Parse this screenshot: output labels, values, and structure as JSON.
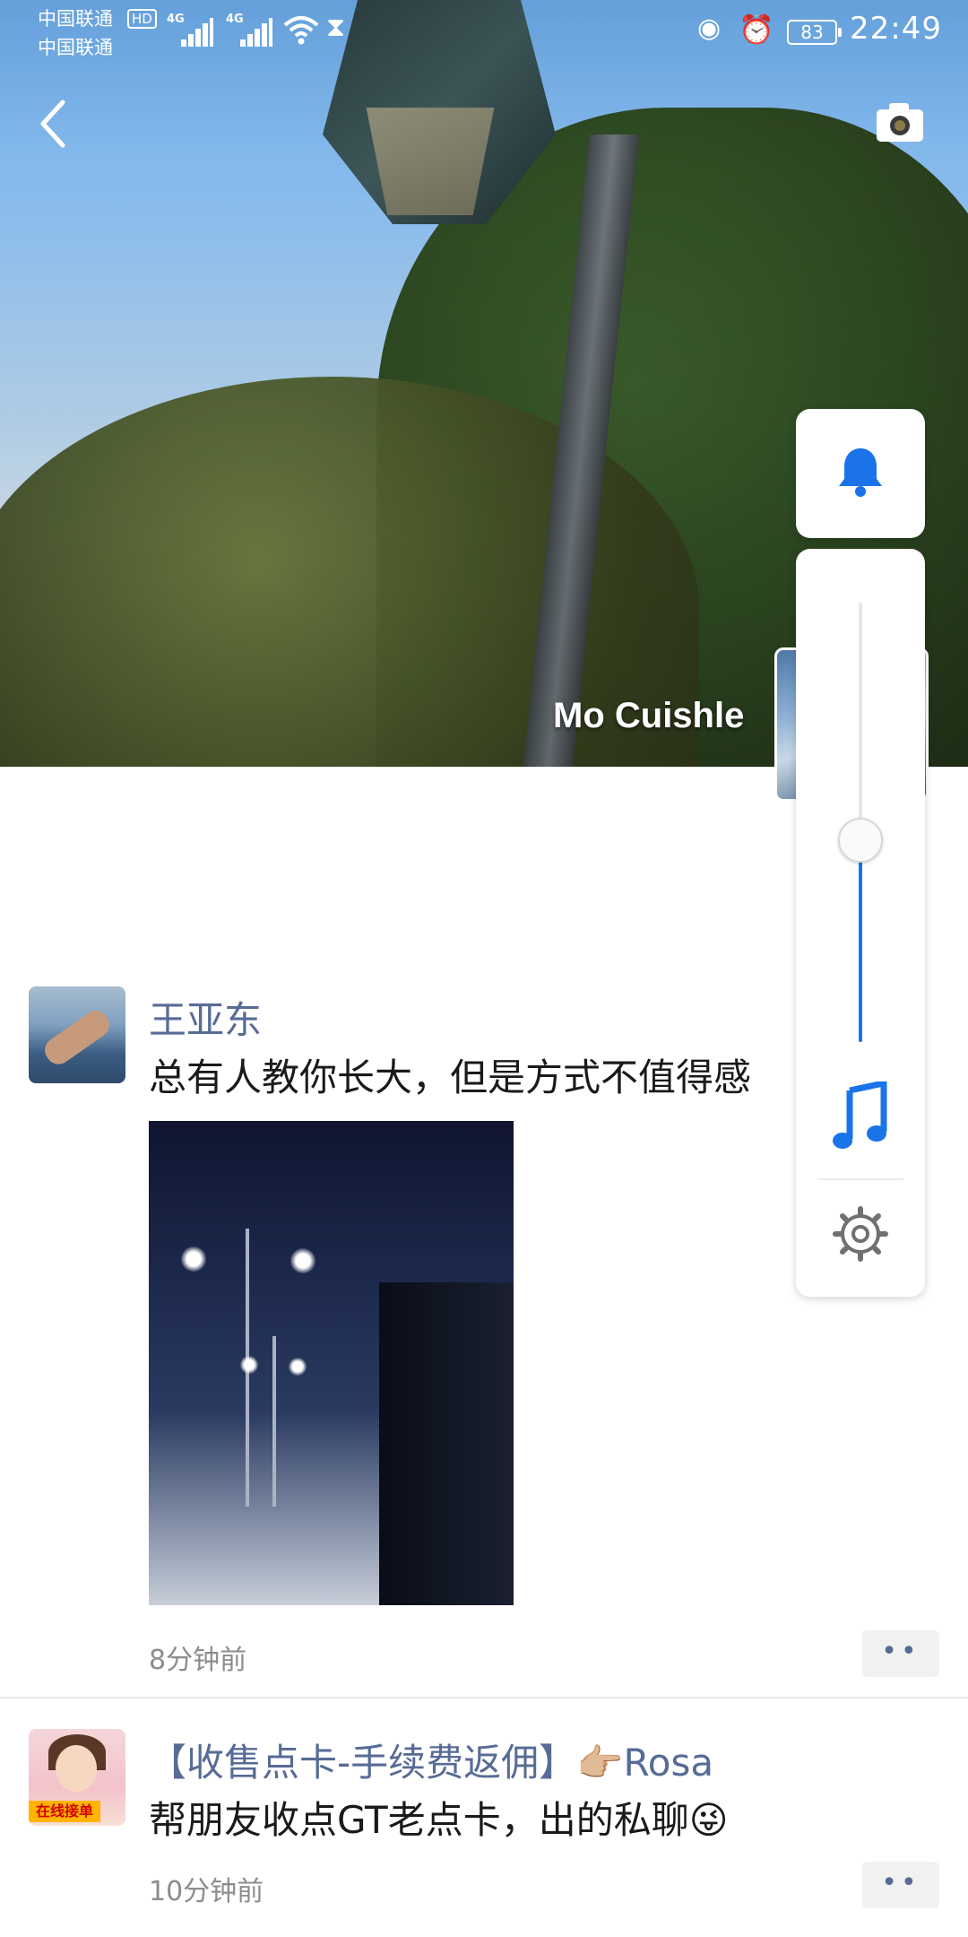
{
  "statusbar": {
    "carrier1": "中国联通",
    "carrier2": "中国联通",
    "hd": "HD",
    "net1": "4G",
    "net2": "4G",
    "battery": "83",
    "time": "22:49"
  },
  "profile": {
    "nickname": "Mo Cuishle"
  },
  "posts": [
    {
      "author": "王亚东",
      "text": "总有人教你长大，但是方式不值得感",
      "time": "8分钟前"
    },
    {
      "author": "【收售点卡-手续费返佣】👉🏼Rosa",
      "text": "帮朋友收点GT老点卡，出的私聊😜",
      "time": "10分钟前",
      "avatar_badge": "在线接单"
    }
  ],
  "more_button": "••",
  "volume": {
    "level": 0.46,
    "accent": "#1a73e8"
  },
  "colors": {
    "name_link": "#576b95",
    "timestamp": "#8c8c8c"
  },
  "icons": [
    "back-icon",
    "camera-icon",
    "bell-icon",
    "music-note-icon",
    "gear-icon"
  ]
}
